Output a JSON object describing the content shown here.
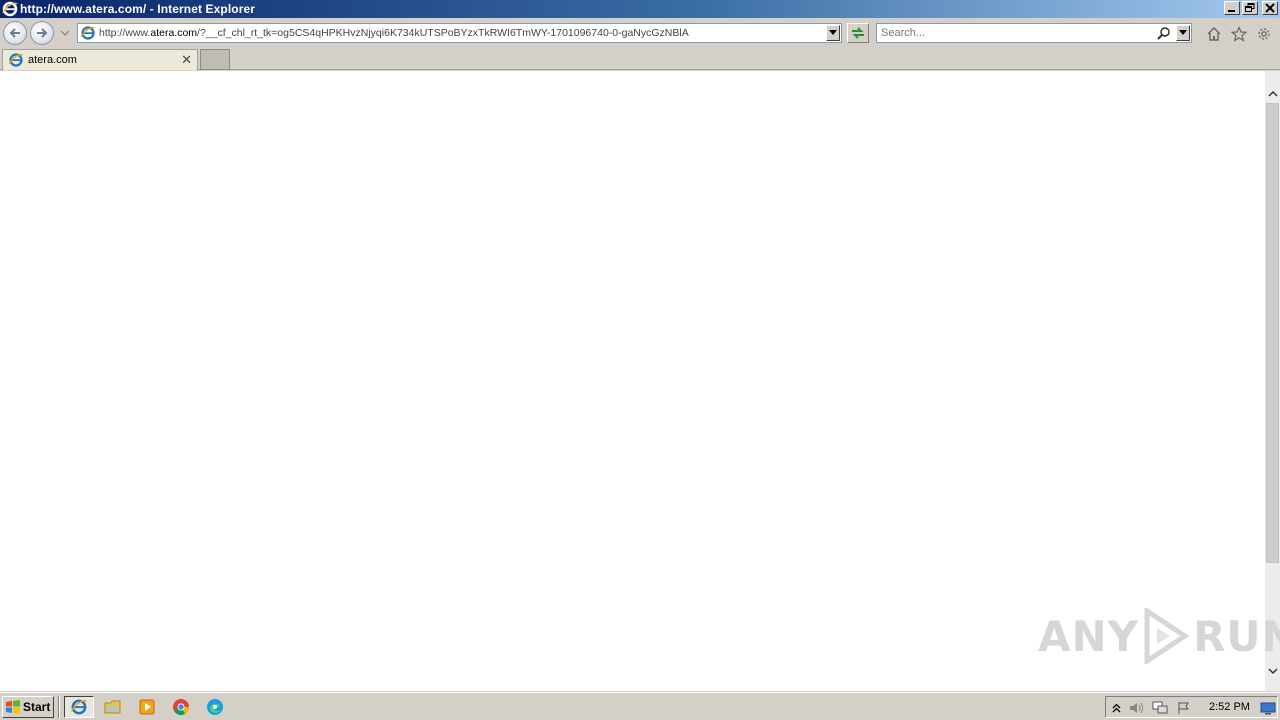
{
  "window": {
    "title": "http://www.atera.com/ - Internet Explorer"
  },
  "address_bar": {
    "url_prefix": "http://www.",
    "url_host": "atera.com",
    "url_rest": "/?__cf_chl_rt_tk=og5CS4qHPKHvzNjyqi6K734kUTSPoBYzxTkRWI6TmWY-1701096740-0-gaNycGzNBlA"
  },
  "search": {
    "placeholder": "Search..."
  },
  "tabs": [
    {
      "label": "atera.com",
      "active": true
    }
  ],
  "watermark": {
    "left": "ANY",
    "right": "RUN"
  },
  "taskbar": {
    "start_label": "Start",
    "pinned": [
      "internet-explorer-icon",
      "file-explorer-icon",
      "media-player-icon",
      "chrome-icon",
      "edge-icon"
    ],
    "clock": "2:52 PM"
  },
  "colors": {
    "title_gradient_start": "#0a246a",
    "title_gradient_end": "#a6caf0",
    "chrome_gray": "#d4d0c8",
    "content_bg": "#ffffff"
  }
}
